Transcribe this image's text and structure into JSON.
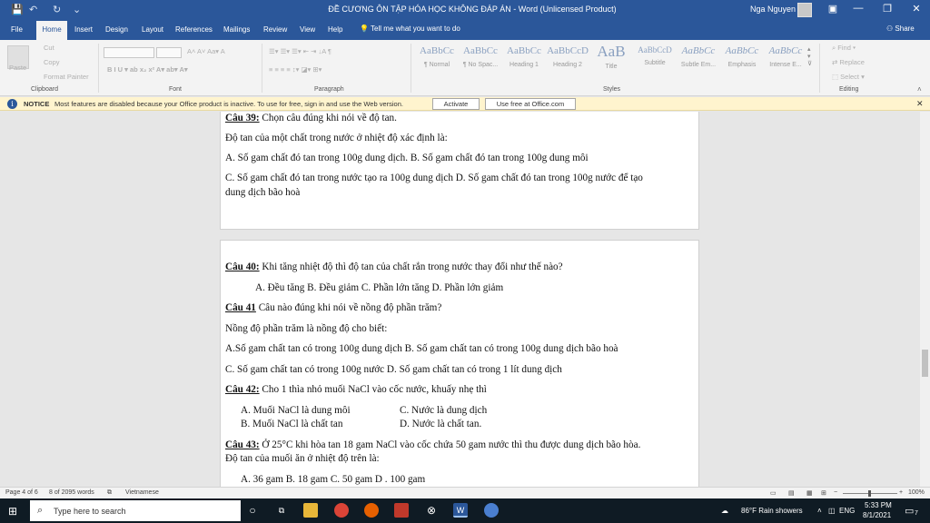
{
  "window": {
    "title": "ĐỀ CƯƠNG ÔN TẬP HÓA HỌC KHÔNG ĐÁP ÁN  -  Word (Unlicensed Product)",
    "user": "Nga Nguyen",
    "quick_access": [
      "💾",
      "↶",
      "↻",
      "⌄"
    ]
  },
  "tabs": [
    "File",
    "Home",
    "Insert",
    "Design",
    "Layout",
    "References",
    "Mailings",
    "Review",
    "View",
    "Help"
  ],
  "tellme": "Tell me what you want to do",
  "share": "Share",
  "ribbon": {
    "clipboard": {
      "paste": "Paste",
      "cut": "Cut",
      "copy": "Copy",
      "format_painter": "Format Painter",
      "label": "Clipboard"
    },
    "font_label": "Font",
    "paragraph_label": "Paragraph",
    "styles_label": "Styles",
    "editing_label": "Editing",
    "styles": [
      {
        "preview": "AaBbCc",
        "name": "¶ Normal"
      },
      {
        "preview": "AaBbCc",
        "name": "¶ No Spac..."
      },
      {
        "preview": "AaBbCc",
        "name": "Heading 1"
      },
      {
        "preview": "AaBbCcD",
        "name": "Heading 2"
      },
      {
        "preview": "AaB",
        "name": "Title"
      },
      {
        "preview": "AaBbCcD",
        "name": "Subtitle"
      },
      {
        "preview": "AaBbCc",
        "name": "Subtle Em..."
      },
      {
        "preview": "AaBbCc",
        "name": "Emphasis"
      },
      {
        "preview": "AaBbCc",
        "name": "Intense E..."
      }
    ],
    "editing": {
      "find": "Find",
      "replace": "Replace",
      "select": "Select"
    }
  },
  "notice": {
    "label": "NOTICE",
    "text": "Most features are disabled because your Office product is inactive. To use for free, sign in and use the Web version.",
    "activate": "Activate",
    "use_free": "Use free at Office.com"
  },
  "document": {
    "page1": {
      "q39_label": "Câu 39:",
      "q39_text": " Chọn câu đúng khi nói về độ tan.",
      "l2": "Độ tan của một chất trong nước ở nhiệt độ xác định là:",
      "l3": "A. Số gam chất đó tan trong 100g dung dịch.   B. Số gam chất đó tan trong 100g dung môi",
      "l4": "C. Số gam chất đó tan trong nước tạo ra  100g dung dịch  D. Số gam chất đó tan trong 100g nước để tạo",
      "l5": "dung dịch bão hoà"
    },
    "page2": {
      "q40_label": "Câu 40:",
      "q40_text": " Khi tăng nhiệt độ thì độ tan của chất rắn trong nước thay đổi như thế nào?",
      "q40_opts": "A. Đều tăng       B. Đều giảm       C. Phần lớn tăng       D. Phần lớn giảm",
      "q41_label": "Câu 41",
      "q41_text": " Câu nào đúng khi nói về nồng độ phần trăm?",
      "l4": "Nồng độ phần trăm là nồng độ cho biết:",
      "l5": "A.Số gam chất tan có trong 100g dung dịch  B. Số gam chất tan có trong 100g dung dịch bão hoà",
      "l6": "C. Số gam chất tan có trong 100g nước         D. Số gam chất tan có trong 1 lít dung dịch",
      "q42_label": "Câu 42:",
      "q42_text": " Cho 1 thìa nhỏ muối NaCl vào cốc nước, khuấy nhẹ thì",
      "q42_a": "A.  Muối NaCl là dung môi",
      "q42_c": "C. Nước là dung dịch",
      "q42_b": "B.  Muối NaCl là chất tan",
      "q42_d": "D. Nước là chất tan.",
      "q43_label": "Câu 43:",
      "q43_text": " Ở 25°C khi hòa tan 18 gam NaCl vào cốc chứa 50 gam nước thì thu được dung dịch bão hòa.",
      "q43_l2": "Độ tan của muối ăn ở nhiệt độ trên là:",
      "q43_opts": "A. 36 gam          B. 18 gam          C. 50 gam          D . 100 gam"
    }
  },
  "status": {
    "page": "Page 4 of 6",
    "words": "8 of 2095 words",
    "language": "Vietnamese",
    "zoom": "100%"
  },
  "taskbar": {
    "search_placeholder": "Type here to search",
    "weather": "86°F  Rain showers",
    "lang": "ENG",
    "time": "5:33 PM",
    "date": "8/1/2021",
    "notifications": "7"
  }
}
